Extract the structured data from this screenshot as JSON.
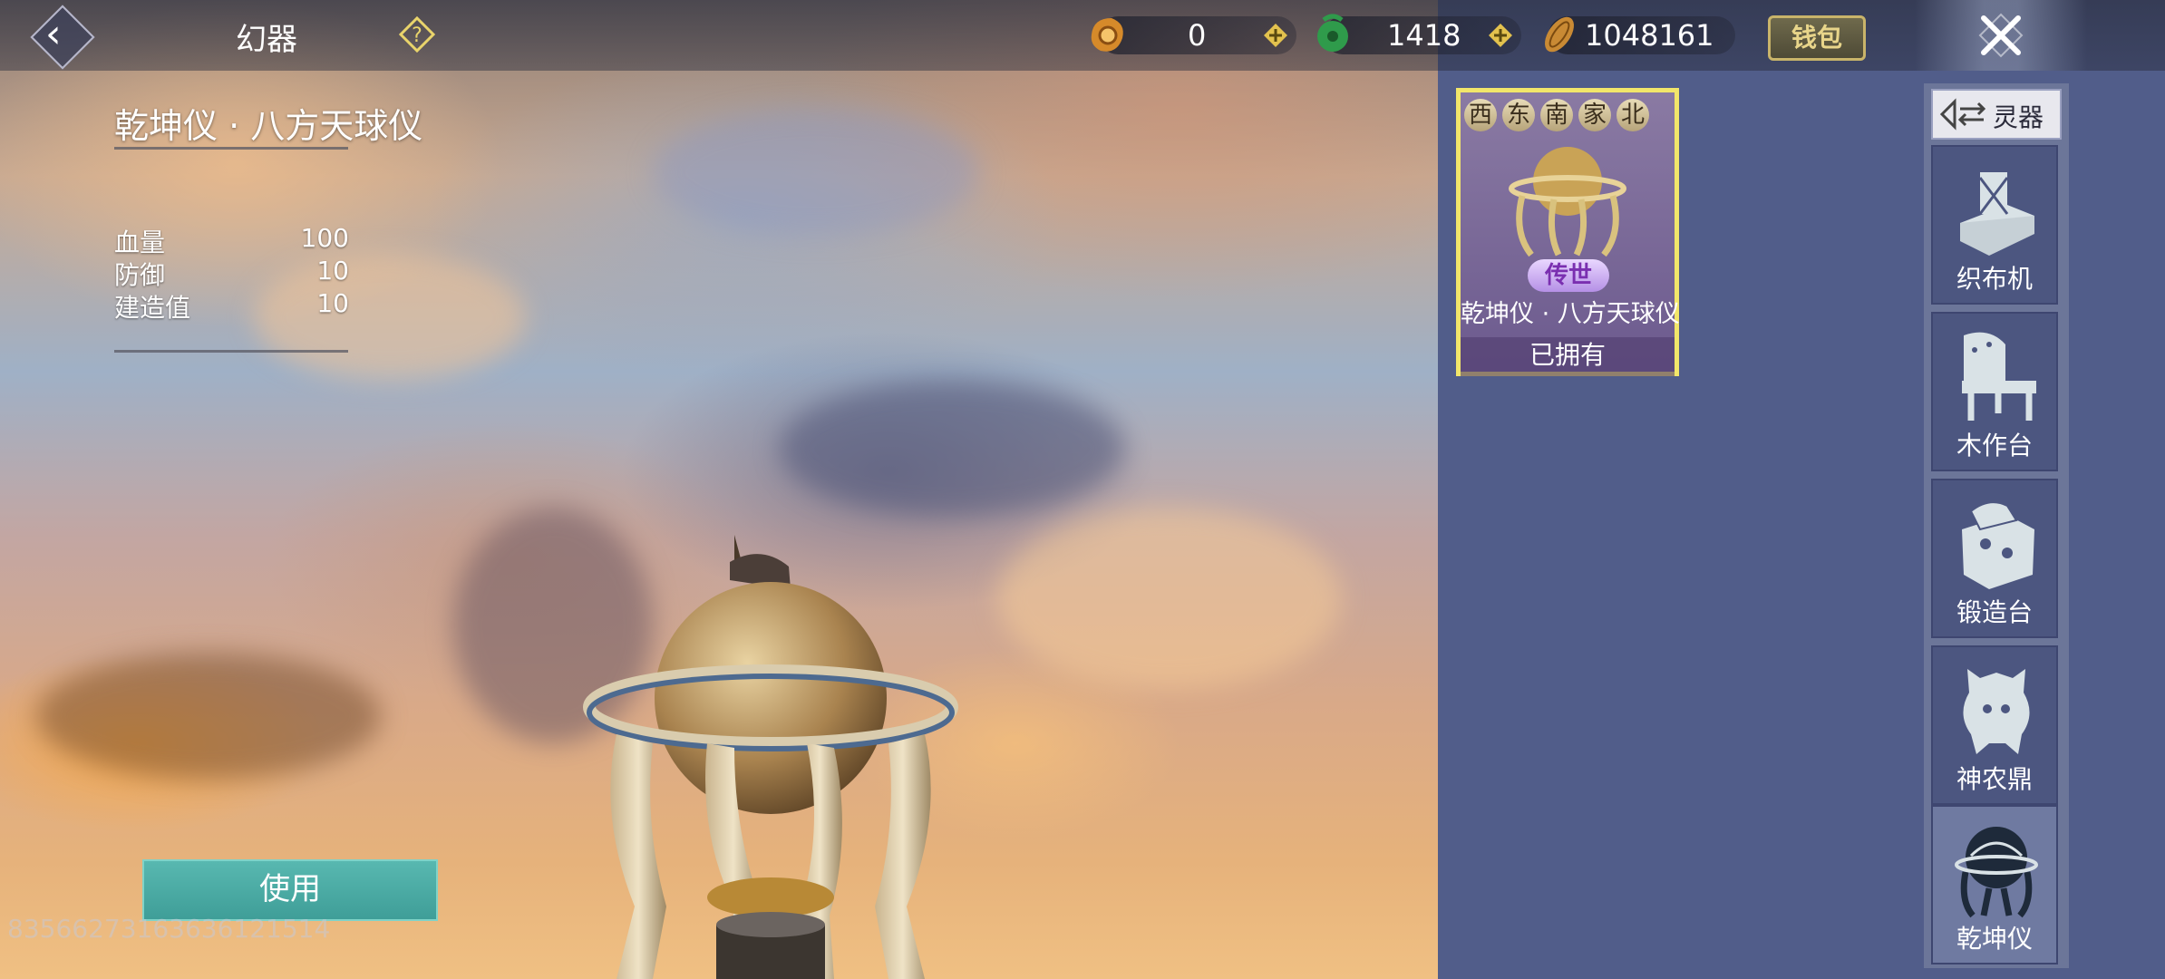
{
  "header": {
    "title": "幻器",
    "resources": [
      {
        "name": "gold-coin-icon",
        "value": "0"
      },
      {
        "name": "jade-icon",
        "value": "1418"
      },
      {
        "name": "copper-coin-icon",
        "value": "1048161"
      }
    ],
    "wallet_label": "钱包"
  },
  "item": {
    "name": "乾坤仪 · 八方天球仪",
    "stats": [
      {
        "label": "血量",
        "value": "100"
      },
      {
        "label": "防御",
        "value": "10"
      },
      {
        "label": "建造值",
        "value": "10"
      }
    ]
  },
  "use_button_label": "使用",
  "player_id": "83566273163636121514",
  "card": {
    "compass": [
      "西",
      "东",
      "南",
      "家",
      "北"
    ],
    "rarity": "传世",
    "name": "乾坤仪 · 八方天球仪",
    "status": "已拥有"
  },
  "tabs": {
    "header_label": "灵器",
    "items": [
      {
        "label": "织布机",
        "icon": "loom-icon"
      },
      {
        "label": "木作台",
        "icon": "woodwork-bench-icon"
      },
      {
        "label": "锻造台",
        "icon": "forge-icon"
      },
      {
        "label": "神农鼎",
        "icon": "cauldron-icon"
      },
      {
        "label": "乾坤仪",
        "icon": "armillary-icon",
        "active": true
      }
    ]
  },
  "colors": {
    "accent": "#f2e66a",
    "use_button": "#4fb0a8",
    "panel": "#515d8a"
  }
}
